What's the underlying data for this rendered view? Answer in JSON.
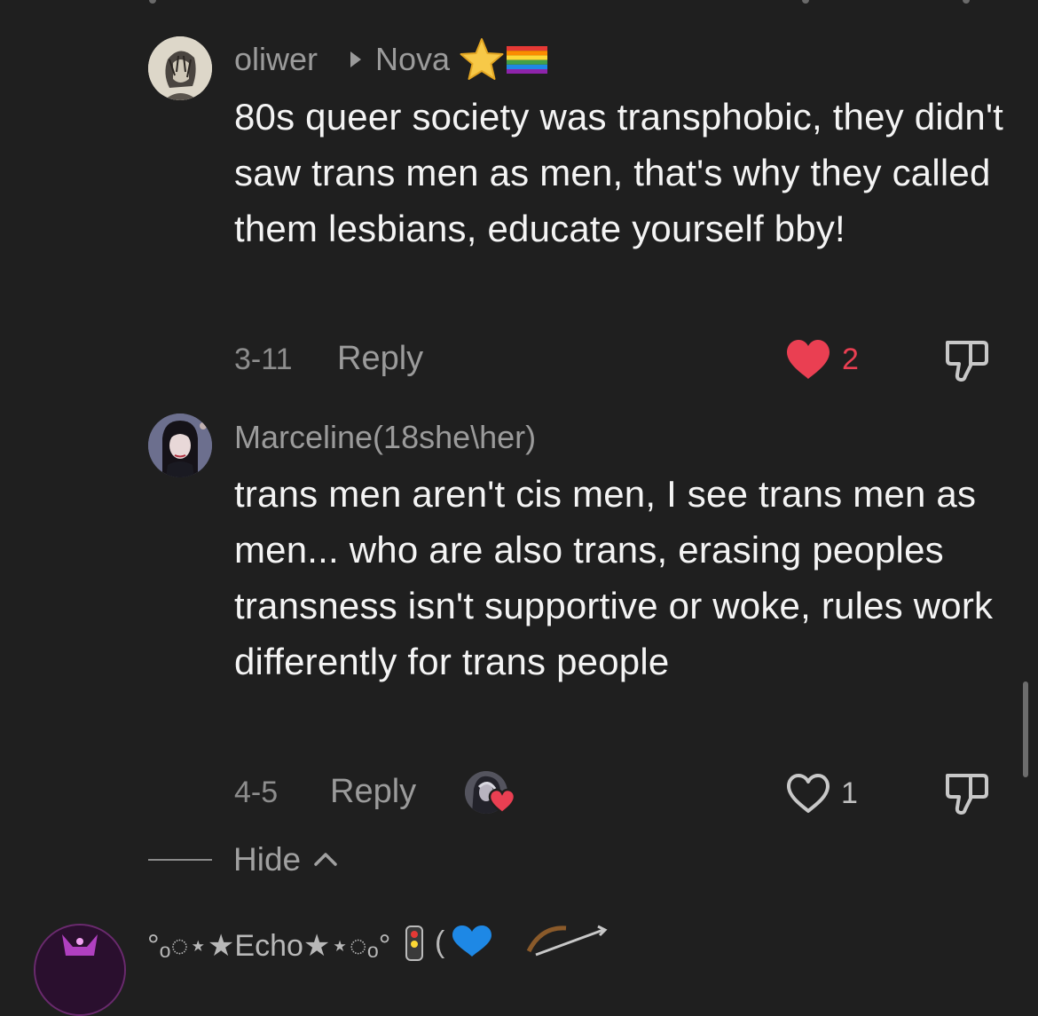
{
  "comments": [
    {
      "username": "oliwer",
      "reply_to": "Nova",
      "reply_to_badges": "⭐🏳️‍🌈",
      "text": "80s queer society was transphobic, they didn't saw trans men as men, that's why they called them lesbians, educate yourself bby!",
      "date": "3-11",
      "reply_label": "Reply",
      "likes": "2",
      "liked": true
    },
    {
      "username": "Marceline(18she\\her)",
      "text": "trans men aren't cis men, I see trans men as men... who are also trans, erasing peoples transness isn't supportive or woke, rules work differently for trans people",
      "date": "4-5",
      "reply_label": "Reply",
      "likes": "1",
      "liked": false
    }
  ],
  "hide_label": "Hide",
  "next_comment": {
    "username": "°ₒ◌⋆★Echo★⋆◌ₒ°"
  },
  "colors": {
    "background": "#1f1f1f",
    "like_red": "#ea3f52",
    "muted_text": "#8d8d8d"
  }
}
